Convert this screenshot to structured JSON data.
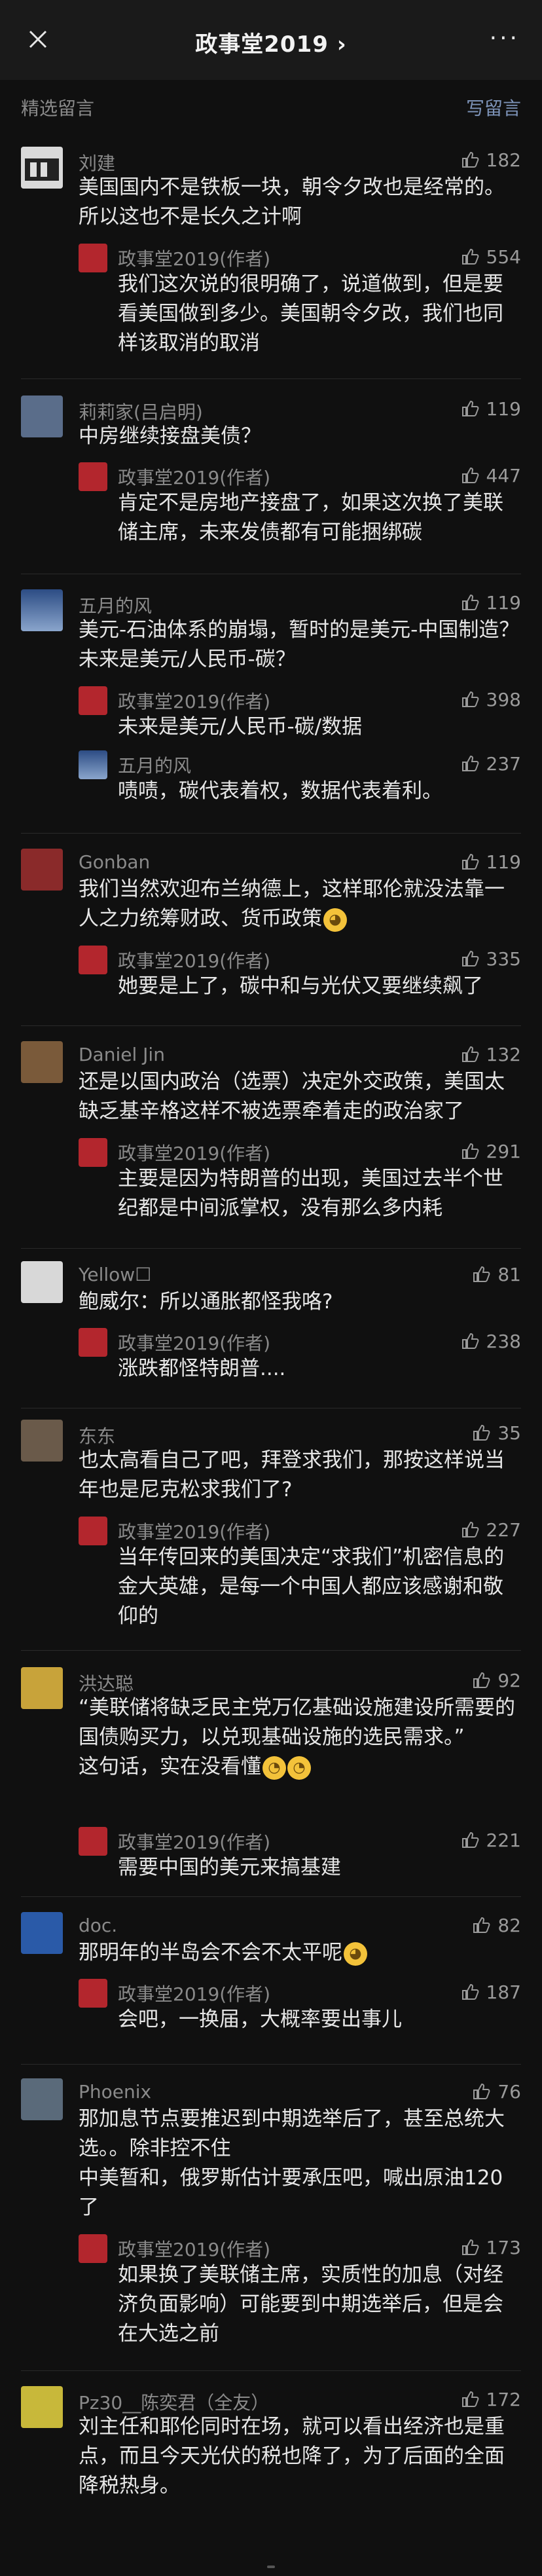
{
  "header": {
    "title": "政事堂2019 ›",
    "more": "···"
  },
  "section": {
    "left": "精选留言",
    "right": "写留言"
  },
  "comments": [
    {
      "nick": "刘建",
      "likes": "182",
      "avatar_color": "#3a3a3a",
      "text": "美国国内不是铁板一块，朝令夕改也是经常的。所以这也不是长久之计啊",
      "reply": {
        "nick": "政事堂2019(作者)",
        "likes": "554",
        "text": "我们这次说的很明确了，说道做到，但是要看美国做到多少。美国朝令夕改，我们也同样该取消的取消"
      }
    },
    {
      "nick": "莉莉家(吕启明)",
      "likes": "119",
      "avatar_color": "#5a6d8a",
      "text": "中房继续接盘美债？",
      "reply": {
        "nick": "政事堂2019(作者)",
        "likes": "447",
        "text": "肯定不是房地产接盘了，如果这次换了美联储主席，未来发债都有可能捆绑碳"
      }
    },
    {
      "nick": "五月的风",
      "likes": "119",
      "avatar_color": "#3c5a88",
      "text": "美元-石油体系的崩塌，暂时的是美元-中国制造？未来是美元/人民币-碳？",
      "reply": {
        "nick": "政事堂2019(作者)",
        "likes": "398",
        "text": "未来是美元/人民币-碳/数据"
      },
      "reply2": {
        "nick": "五月的风",
        "likes": "237",
        "text": "啧啧，碳代表着权，数据代表着利。"
      }
    },
    {
      "nick": "Gonban",
      "likes": "119",
      "avatar_color": "#8a2a2a",
      "text": "我们当然欢迎布兰纳德上，这样耶伦就没法靠一人之力统筹财政、货币政策",
      "reply": {
        "nick": "政事堂2019(作者)",
        "likes": "335",
        "text": "她要是上了，碳中和与光伏又要继续飙了"
      }
    },
    {
      "nick": "Daniel Jin",
      "likes": "132",
      "avatar_color": "#7a5a3a",
      "text": "还是以国内政治（选票）决定外交政策，美国太缺乏基辛格这样不被选票牵着走的政治家了",
      "reply": {
        "nick": "政事堂2019(作者)",
        "likes": "291",
        "text": "主要是因为特朗普的出现，美国过去半个世纪都是中间派掌权，没有那么多内耗"
      }
    },
    {
      "nick": "Yellow☐",
      "likes": "81",
      "avatar_color": "#d8d8d8",
      "text": "鲍威尔：所以通胀都怪我咯?",
      "reply": {
        "nick": "政事堂2019(作者)",
        "likes": "238",
        "text": "涨跌都怪特朗普...."
      }
    },
    {
      "nick": "东东",
      "likes": "35",
      "avatar_color": "#6a5a4a",
      "text": "也太高看自己了吧，拜登求我们，那按这样说当年也是尼克松求我们了?",
      "reply": {
        "nick": "政事堂2019(作者)",
        "likes": "227",
        "text": "当年传回来的美国决定“求我们”机密信息的金大英雄，是每一个中国人都应该感谢和敬仰的"
      }
    },
    {
      "nick": "洪达聪",
      "likes": "92",
      "avatar_color": "#c8a33a",
      "text": "“美联储将缺乏民主党万亿基础设施建设所需要的国债购买力，以兑现基础设施的选民需求。”\n这句话，实在没看懂",
      "reply": {
        "nick": "政事堂2019(作者)",
        "likes": "221",
        "text": "需要中国的美元来搞基建"
      }
    },
    {
      "nick": "doc.",
      "likes": "82",
      "avatar_color": "#2a5aa8",
      "text": "那明年的半岛会不会不太平呢",
      "reply": {
        "nick": "政事堂2019(作者)",
        "likes": "187",
        "text": "会吧，一换届，大概率要出事儿"
      }
    },
    {
      "nick": "Phoenix",
      "likes": "76",
      "avatar_color": "#5a6a7a",
      "text": "那加息节点要推迟到中期选举后了，甚至总统大选。。除非控不住\n中美暂和，俄罗斯估计要承压吧，喊出原油120了",
      "reply": {
        "nick": "政事堂2019(作者)",
        "likes": "173",
        "text": "如果换了美联储主席，实质性的加息（对经济负面影响）可能要到中期选举后，但是会在大选之前"
      }
    },
    {
      "nick": "Pz30__陈奕君（全友）",
      "likes": "172",
      "avatar_color": "#c8b83a",
      "text": "刘主任和耶伦同时在场，就可以看出经济也是重点，而且今天光伏的税也降了，为了后面的全面降税热身。"
    }
  ]
}
